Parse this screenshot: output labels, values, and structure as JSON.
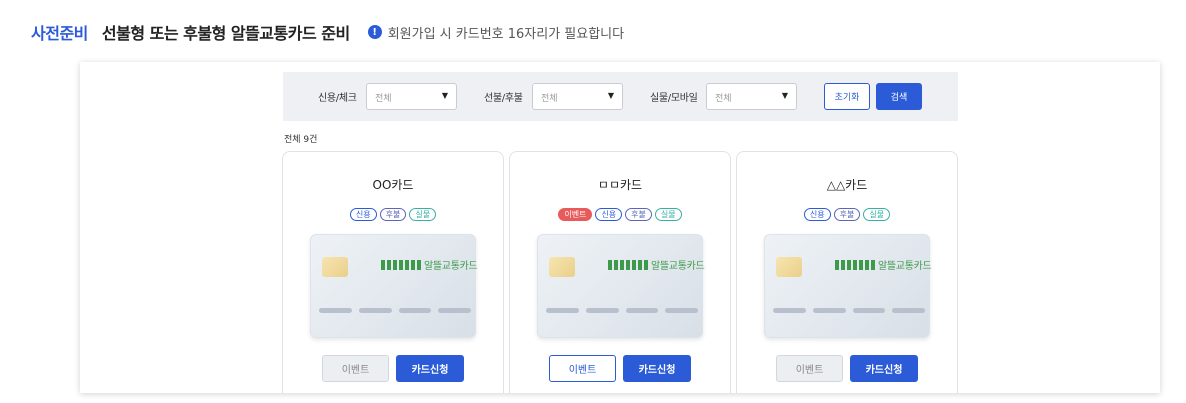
{
  "header": {
    "badge": "사전준비",
    "title": "선불형 또는 후불형 알뜰교통카드 준비",
    "info_icon": "info-circle-icon",
    "note": "회원가입 시 카드번호 16자리가 필요합니다"
  },
  "filters": [
    {
      "label": "신용/체크",
      "value": "전체"
    },
    {
      "label": "선불/후불",
      "value": "전체"
    },
    {
      "label": "실물/모바일",
      "value": "전체"
    }
  ],
  "buttons": {
    "reset": "초기화",
    "search": "검색"
  },
  "count_label": "전체 9건",
  "cards": [
    {
      "name": "OO카드",
      "tags": [
        {
          "text": "신용",
          "kind": "credit"
        },
        {
          "text": "후불",
          "kind": "post"
        },
        {
          "text": "실물",
          "kind": "real"
        }
      ],
      "logo_text": "알뜰교통카드",
      "event_label": "이벤트",
      "event_active": false,
      "apply_label": "카드신청"
    },
    {
      "name": "ㅁㅁ카드",
      "tags": [
        {
          "text": "이벤트",
          "kind": "event"
        },
        {
          "text": "신용",
          "kind": "credit"
        },
        {
          "text": "후불",
          "kind": "post"
        },
        {
          "text": "실물",
          "kind": "real"
        }
      ],
      "logo_text": "알뜰교통카드",
      "event_label": "이벤트",
      "event_active": true,
      "apply_label": "카드신청"
    },
    {
      "name": "△△카드",
      "tags": [
        {
          "text": "신용",
          "kind": "credit"
        },
        {
          "text": "후불",
          "kind": "post"
        },
        {
          "text": "실물",
          "kind": "real"
        }
      ],
      "logo_text": "알뜰교통카드",
      "event_label": "이벤트",
      "event_active": false,
      "apply_label": "카드신청"
    }
  ],
  "colors": {
    "accent": "#2b5bd7",
    "event": "#e85b5b",
    "real": "#36b0a6",
    "post": "#5a66b8",
    "logo": "#3c9a4a"
  }
}
